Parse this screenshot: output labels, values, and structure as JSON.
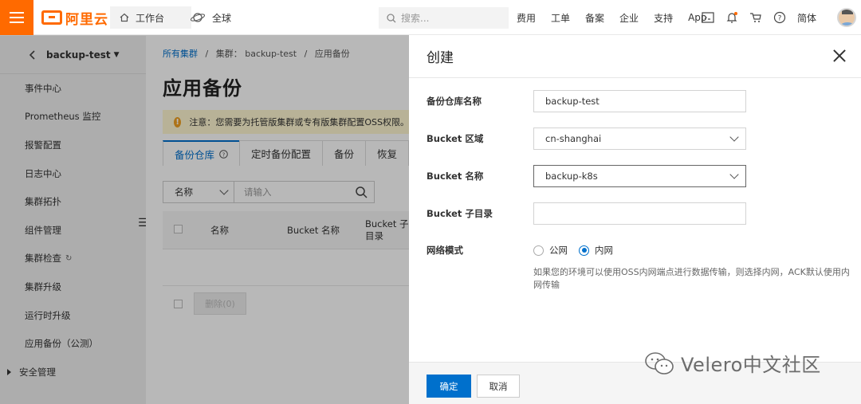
{
  "topbar": {
    "logo_text": "阿里云",
    "workbench": "工作台",
    "region": "全球",
    "search_placeholder": "搜索...",
    "links": [
      "费用",
      "工单",
      "备案",
      "企业",
      "支持",
      "App"
    ],
    "language": "简体",
    "brand_color": "#ff6a00"
  },
  "sidebar": {
    "cluster_name": "backup-test",
    "items": [
      {
        "label": "事件中心"
      },
      {
        "label": "Prometheus 监控"
      },
      {
        "label": "报警配置"
      },
      {
        "label": "日志中心"
      },
      {
        "label": "集群拓扑"
      },
      {
        "label": "组件管理"
      },
      {
        "label": "集群检查"
      },
      {
        "label": "集群升级"
      },
      {
        "label": "运行时升级"
      },
      {
        "label": "应用备份（公测）"
      },
      {
        "label": "安全管理"
      }
    ]
  },
  "main": {
    "breadcrumb": {
      "root": "所有集群",
      "sep": "/",
      "cluster": "集群： backup-test",
      "current": "应用备份"
    },
    "title": "应用备份",
    "notice": "注意：您需要为托管版集群或专有版集群配置OSS权限。",
    "tabs": [
      "备份仓库",
      "定时备份配置",
      "备份",
      "恢复"
    ],
    "filter_select": "名称",
    "filter_placeholder": "请输入",
    "columns": [
      "名称",
      "Bucket 名称",
      "Bucket 子目录"
    ],
    "delete_button": "删除(0)"
  },
  "drawer": {
    "title": "创建",
    "fields": {
      "repo_name_label": "备份仓库名称",
      "repo_name_value": "backup-test",
      "region_label": "Bucket 区域",
      "region_value": "cn-shanghai",
      "bucket_label": "Bucket 名称",
      "bucket_value": "backup-k8s",
      "subdir_label": "Bucket 子目录",
      "subdir_value": "",
      "network_label": "网络模式",
      "network_options": [
        "公网",
        "内网"
      ],
      "network_selected": "内网"
    },
    "hint": "如果您的环境可以使用OSS内网端点进行数据传输，则选择内网，ACK默认使用内网传输",
    "confirm": "确定",
    "cancel": "取消",
    "accent_color": "#0070cc"
  },
  "watermark": "Velero中文社区"
}
